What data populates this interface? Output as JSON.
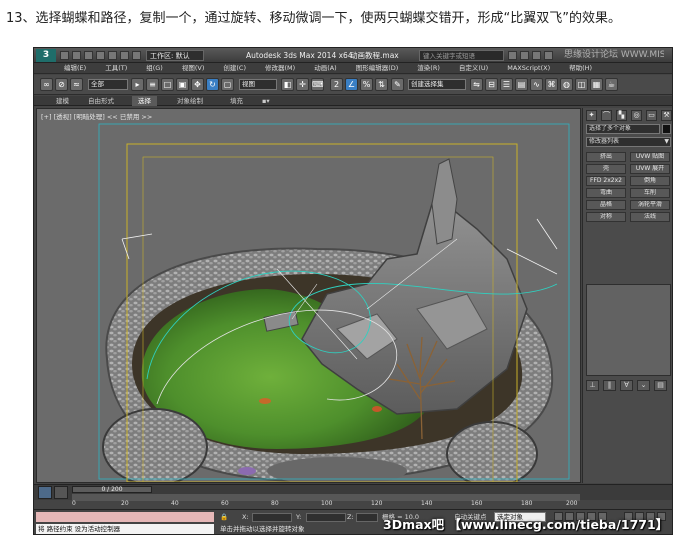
{
  "caption": "13、选择蝴蝶和路径，复制一个，通过旋转、移动微调一下，使两只蝴蝶交错开，形成“比翼双飞”的效果。",
  "titlebar": {
    "workspace": "工作区: 默认",
    "app_title": "Autodesk 3ds Max  2014 x64",
    "file_title": "动画教程.max",
    "search_placeholder": "键入关键字或短语",
    "watermark": "思缘设计论坛 WWW.MISSYUAN.COM"
  },
  "menubar": [
    "编辑(E)",
    "工具(T)",
    "组(G)",
    "视图(V)",
    "创建(C)",
    "修改器(M)",
    "动画(A)",
    "图形编辑器(D)",
    "渲染(R)",
    "自定义(U)",
    "MAXScript(X)",
    "帮助(H)"
  ],
  "toolbar": {
    "filter": "全部",
    "refcoord": "视图",
    "named_sel": "创建选择集"
  },
  "ribbon": {
    "tabs": [
      "建模",
      "自由形式",
      "选择",
      "对象绘制",
      "填充"
    ]
  },
  "viewport": {
    "label": "[+] [透视] [明暗处理] << 已禁用 >>"
  },
  "cmdpanel": {
    "object_name": "选择了多个对象",
    "modifier_list": "修改器列表",
    "modifiers": [
      "挤出",
      "UVW 贴图",
      "壳",
      "UVW 展开",
      "FFD 2x2x2",
      "倒角",
      "弯曲",
      "车削",
      "晶格",
      "涡轮平滑",
      "对称",
      "法线"
    ]
  },
  "timeline": {
    "frame": "0 / 200",
    "ticks": [
      "0",
      "20",
      "40",
      "60",
      "80",
      "100",
      "120",
      "140",
      "160",
      "180",
      "200"
    ]
  },
  "status": {
    "line1": "",
    "line2": "将 路径约束 设为活动控制器",
    "x_label": "X:",
    "y_label": "Y:",
    "z_label": "Z:",
    "grid": "栅格 = 10.0",
    "auto_key": "自动关键点",
    "selection": "选定对象",
    "prompt": "单击并拖动以选择并旋转对象"
  },
  "footer_watermark": "3Dmax吧 【www.linecg.com/tieba/1771】",
  "colors": {
    "accent_blue": "#3a7fc4",
    "grass": "#4e8f2c",
    "rock": "#8a8a8a",
    "safe_frame_yellow": "#c8b02a",
    "safe_frame_cyan": "#2fb3c4"
  }
}
